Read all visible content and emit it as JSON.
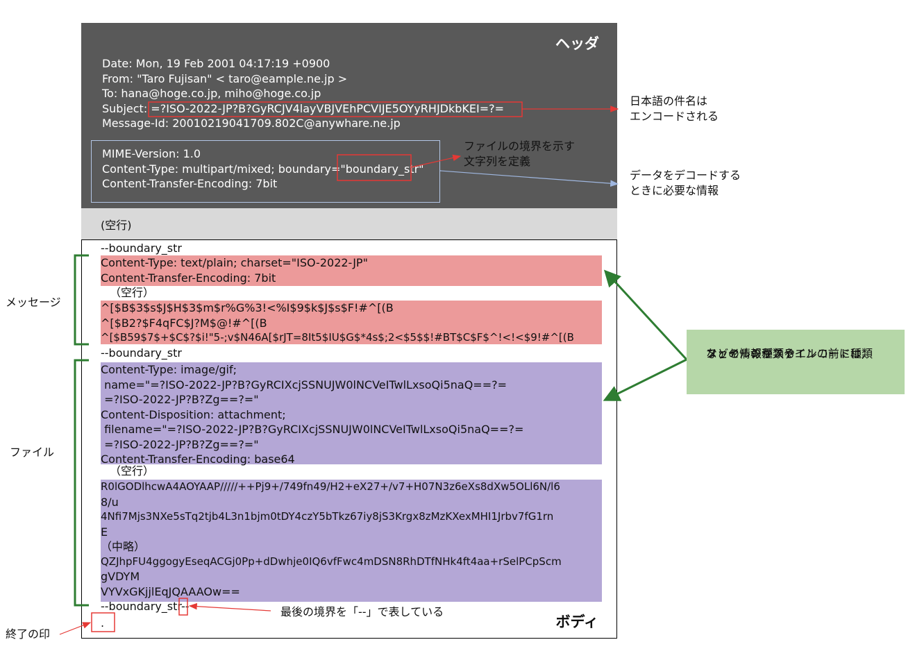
{
  "header": {
    "title": "ヘッダ",
    "lines": [
      "Date: Mon, 19 Feb 2001 04:17:19 +0900",
      "From: \"Taro Fujisan\" < taro@eample.ne.jp >",
      "To: hana@hoge.co.jp, miho@hoge.co.jp",
      "Subject: =?ISO-2022-JP?B?GyRCJV4layVBJVEhPCVIJE5OYyRHJDkbKEI=?=",
      "Message-Id: 20010219041709.802C@anywhare.ne.jp"
    ],
    "mime_lines": [
      "MIME-Version: 1.0",
      "Content-Type: multipart/mixed; boundary=\"boundary_str\"",
      "Content-Transfer-Encoding: 7bit"
    ]
  },
  "blank_line": "(空行)",
  "body": {
    "title": "ボディ",
    "boundary1": "--boundary_str",
    "message_headers": [
      "Content-Type: text/plain; charset=\"ISO-2022-JP\"",
      "Content-Transfer-Encoding: 7bit"
    ],
    "message_blank": "（空行）",
    "message_data": [
      "^[$B$3$s$J$H$3$m$r%G%3!<%I$9$k$J$s$F!#^[(B",
      "^[$B2?$F4qFC$J?M$@!#^[(B",
      "^[$B59$7$+$C$?$i!\"5-;v$N46A[$rJT=8It5$IU$G$*4s$;2<$5$$!#BT$C$F$^!<!<$9!#^[(B"
    ],
    "boundary2": "--boundary_str",
    "file_headers": [
      "Content-Type: image/gif;",
      " name=\"=?ISO-2022-JP?B?GyRCIXcjSSNUJW0lNCVeITwlLxsoQi5naQ==?=",
      " =?ISO-2022-JP?B?Zg==?=\"",
      "Content-Disposition: attachment;",
      " filename=\"=?ISO-2022-JP?B?GyRCIXcjSSNUJW0lNCVeITwlLxsoQi5naQ==?=",
      " =?ISO-2022-JP?B?Zg==?=\"",
      "Content-Transfer-Encoding: base64"
    ],
    "file_blank": "（空行）",
    "file_data": [
      "R0lGODlhcwA4AOYAAP/////++Pj9+/749fn49/H2+eX27+/v7+H07N3z6eXs8dXw5OLl6N/l6",
      "8/u",
      "4Nfi7Mjs3NXe5sTq2tjb4L3n1bjm0tDY4czY5bTkz67iy8jS3Krgx8zMzKXexMHI1Jrbv7fG1rn",
      "E",
      "（中略）",
      "QZJhpFU4ggogyEseqACGj0Pp+dDwhje0IQ6vfFwc4mDSN8RhDTfNHk4ft4aa+rSelPCpScm",
      "gVDYM",
      "VYVxGKjjlEqJQAAAOw=="
    ],
    "final_boundary": "--boundary_str--",
    "end_mark": "."
  },
  "annotations": {
    "subject": [
      "日本語の件名は",
      "エンコードされる"
    ],
    "boundary": [
      "ファイルの境界を示す",
      "文字列を定義"
    ],
    "encoding": [
      "データをデコードする",
      "ときに必要な情報"
    ],
    "message_label": "メッセージ",
    "file_label": "ファイル",
    "green_note": [
      "メッセージやファイルの前には,",
      "ファイルの種類やエンコード種類",
      "などの情報が入る"
    ],
    "last_boundary": "最後の境界を「--」で表している",
    "end_label": "終了の印"
  },
  "colors": {
    "header_bg": "#595959",
    "blank_bg": "#d9d9d9",
    "message_bg": "#ec9a9a",
    "file_bg": "#b4a7d6",
    "note_bg": "#b6d7a8",
    "bracket": "#2e7d32",
    "highlight": "#e53935",
    "mime_border": "#b4c7e7"
  }
}
